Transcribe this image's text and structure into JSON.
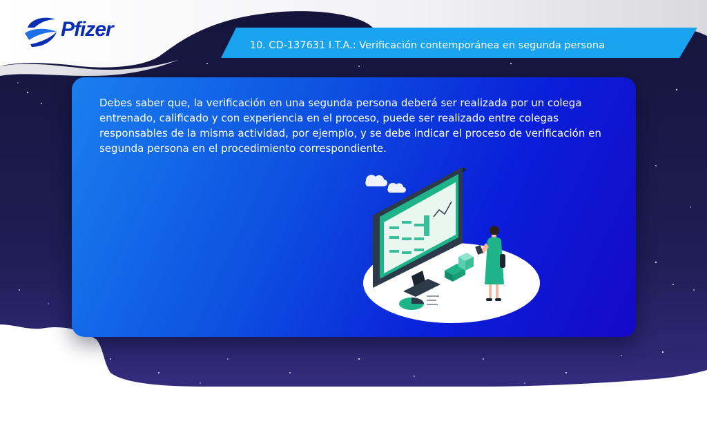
{
  "brand": {
    "logo_text": "Pfizer"
  },
  "header": {
    "title": "10. CD-137631 I.T.A.: Verificación contemporánea en segunda persona"
  },
  "card": {
    "body": "Debes saber que, la verificación en una segunda persona deberá ser realizada por un colega entrenado, calificado y con experiencia en el proceso, puede ser realizado entre colegas responsables de la misma actividad, por ejemplo, y se debe indicar el proceso de verificación en segunda persona en el procedimiento correspondiente."
  },
  "colors": {
    "brand_blue": "#0a2fb5",
    "title_bar": "#1aa3ee",
    "card_start": "#1a7fee",
    "card_end": "#1508c8",
    "sky": "#1b1b4a",
    "accent_teal": "#1fb38a"
  },
  "icons": [
    "pfizer-logo-icon",
    "cloud-icon",
    "monitor-icon",
    "woman-figure-icon",
    "pie-chart-icon"
  ]
}
